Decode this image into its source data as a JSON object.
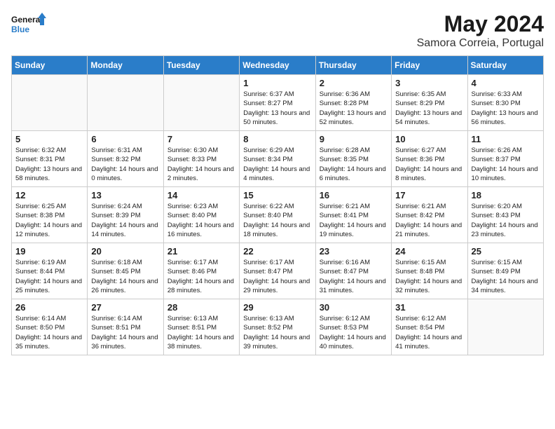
{
  "logo": {
    "line1": "General",
    "line2": "Blue"
  },
  "title": "May 2024",
  "subtitle": "Samora Correia, Portugal",
  "days_of_week": [
    "Sunday",
    "Monday",
    "Tuesday",
    "Wednesday",
    "Thursday",
    "Friday",
    "Saturday"
  ],
  "weeks": [
    [
      {
        "num": "",
        "sunrise": "",
        "sunset": "",
        "daylight": ""
      },
      {
        "num": "",
        "sunrise": "",
        "sunset": "",
        "daylight": ""
      },
      {
        "num": "",
        "sunrise": "",
        "sunset": "",
        "daylight": ""
      },
      {
        "num": "1",
        "sunrise": "Sunrise: 6:37 AM",
        "sunset": "Sunset: 8:27 PM",
        "daylight": "Daylight: 13 hours and 50 minutes."
      },
      {
        "num": "2",
        "sunrise": "Sunrise: 6:36 AM",
        "sunset": "Sunset: 8:28 PM",
        "daylight": "Daylight: 13 hours and 52 minutes."
      },
      {
        "num": "3",
        "sunrise": "Sunrise: 6:35 AM",
        "sunset": "Sunset: 8:29 PM",
        "daylight": "Daylight: 13 hours and 54 minutes."
      },
      {
        "num": "4",
        "sunrise": "Sunrise: 6:33 AM",
        "sunset": "Sunset: 8:30 PM",
        "daylight": "Daylight: 13 hours and 56 minutes."
      }
    ],
    [
      {
        "num": "5",
        "sunrise": "Sunrise: 6:32 AM",
        "sunset": "Sunset: 8:31 PM",
        "daylight": "Daylight: 13 hours and 58 minutes."
      },
      {
        "num": "6",
        "sunrise": "Sunrise: 6:31 AM",
        "sunset": "Sunset: 8:32 PM",
        "daylight": "Daylight: 14 hours and 0 minutes."
      },
      {
        "num": "7",
        "sunrise": "Sunrise: 6:30 AM",
        "sunset": "Sunset: 8:33 PM",
        "daylight": "Daylight: 14 hours and 2 minutes."
      },
      {
        "num": "8",
        "sunrise": "Sunrise: 6:29 AM",
        "sunset": "Sunset: 8:34 PM",
        "daylight": "Daylight: 14 hours and 4 minutes."
      },
      {
        "num": "9",
        "sunrise": "Sunrise: 6:28 AM",
        "sunset": "Sunset: 8:35 PM",
        "daylight": "Daylight: 14 hours and 6 minutes."
      },
      {
        "num": "10",
        "sunrise": "Sunrise: 6:27 AM",
        "sunset": "Sunset: 8:36 PM",
        "daylight": "Daylight: 14 hours and 8 minutes."
      },
      {
        "num": "11",
        "sunrise": "Sunrise: 6:26 AM",
        "sunset": "Sunset: 8:37 PM",
        "daylight": "Daylight: 14 hours and 10 minutes."
      }
    ],
    [
      {
        "num": "12",
        "sunrise": "Sunrise: 6:25 AM",
        "sunset": "Sunset: 8:38 PM",
        "daylight": "Daylight: 14 hours and 12 minutes."
      },
      {
        "num": "13",
        "sunrise": "Sunrise: 6:24 AM",
        "sunset": "Sunset: 8:39 PM",
        "daylight": "Daylight: 14 hours and 14 minutes."
      },
      {
        "num": "14",
        "sunrise": "Sunrise: 6:23 AM",
        "sunset": "Sunset: 8:40 PM",
        "daylight": "Daylight: 14 hours and 16 minutes."
      },
      {
        "num": "15",
        "sunrise": "Sunrise: 6:22 AM",
        "sunset": "Sunset: 8:40 PM",
        "daylight": "Daylight: 14 hours and 18 minutes."
      },
      {
        "num": "16",
        "sunrise": "Sunrise: 6:21 AM",
        "sunset": "Sunset: 8:41 PM",
        "daylight": "Daylight: 14 hours and 19 minutes."
      },
      {
        "num": "17",
        "sunrise": "Sunrise: 6:21 AM",
        "sunset": "Sunset: 8:42 PM",
        "daylight": "Daylight: 14 hours and 21 minutes."
      },
      {
        "num": "18",
        "sunrise": "Sunrise: 6:20 AM",
        "sunset": "Sunset: 8:43 PM",
        "daylight": "Daylight: 14 hours and 23 minutes."
      }
    ],
    [
      {
        "num": "19",
        "sunrise": "Sunrise: 6:19 AM",
        "sunset": "Sunset: 8:44 PM",
        "daylight": "Daylight: 14 hours and 25 minutes."
      },
      {
        "num": "20",
        "sunrise": "Sunrise: 6:18 AM",
        "sunset": "Sunset: 8:45 PM",
        "daylight": "Daylight: 14 hours and 26 minutes."
      },
      {
        "num": "21",
        "sunrise": "Sunrise: 6:17 AM",
        "sunset": "Sunset: 8:46 PM",
        "daylight": "Daylight: 14 hours and 28 minutes."
      },
      {
        "num": "22",
        "sunrise": "Sunrise: 6:17 AM",
        "sunset": "Sunset: 8:47 PM",
        "daylight": "Daylight: 14 hours and 29 minutes."
      },
      {
        "num": "23",
        "sunrise": "Sunrise: 6:16 AM",
        "sunset": "Sunset: 8:47 PM",
        "daylight": "Daylight: 14 hours and 31 minutes."
      },
      {
        "num": "24",
        "sunrise": "Sunrise: 6:15 AM",
        "sunset": "Sunset: 8:48 PM",
        "daylight": "Daylight: 14 hours and 32 minutes."
      },
      {
        "num": "25",
        "sunrise": "Sunrise: 6:15 AM",
        "sunset": "Sunset: 8:49 PM",
        "daylight": "Daylight: 14 hours and 34 minutes."
      }
    ],
    [
      {
        "num": "26",
        "sunrise": "Sunrise: 6:14 AM",
        "sunset": "Sunset: 8:50 PM",
        "daylight": "Daylight: 14 hours and 35 minutes."
      },
      {
        "num": "27",
        "sunrise": "Sunrise: 6:14 AM",
        "sunset": "Sunset: 8:51 PM",
        "daylight": "Daylight: 14 hours and 36 minutes."
      },
      {
        "num": "28",
        "sunrise": "Sunrise: 6:13 AM",
        "sunset": "Sunset: 8:51 PM",
        "daylight": "Daylight: 14 hours and 38 minutes."
      },
      {
        "num": "29",
        "sunrise": "Sunrise: 6:13 AM",
        "sunset": "Sunset: 8:52 PM",
        "daylight": "Daylight: 14 hours and 39 minutes."
      },
      {
        "num": "30",
        "sunrise": "Sunrise: 6:12 AM",
        "sunset": "Sunset: 8:53 PM",
        "daylight": "Daylight: 14 hours and 40 minutes."
      },
      {
        "num": "31",
        "sunrise": "Sunrise: 6:12 AM",
        "sunset": "Sunset: 8:54 PM",
        "daylight": "Daylight: 14 hours and 41 minutes."
      },
      {
        "num": "",
        "sunrise": "",
        "sunset": "",
        "daylight": ""
      }
    ]
  ]
}
